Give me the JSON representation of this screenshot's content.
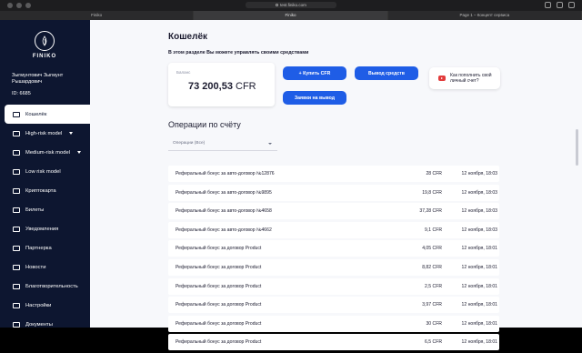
{
  "browser": {
    "url": "test.finiko.com",
    "tabs": [
      "Finiko",
      "Finiko",
      "Page 1 – Концепт сервиса"
    ]
  },
  "sidebar": {
    "logo_text": "FINIKO",
    "user_name": "Зыгмунтович Зыгмунт Рышардович",
    "user_id": "ID: 6685",
    "items": [
      {
        "label": "Кошелёк",
        "icon": "wallet-icon",
        "active": true
      },
      {
        "label": "High-risk model",
        "icon": "chart-icon",
        "has_caret": true
      },
      {
        "label": "Medium-risk model",
        "icon": "chart-icon",
        "has_caret": true
      },
      {
        "label": "Low risk model",
        "icon": "chart-icon"
      },
      {
        "label": "Криптокарта",
        "icon": "card-icon"
      },
      {
        "label": "Билеты",
        "icon": "ticket-icon"
      },
      {
        "label": "Уведомления",
        "icon": "bell-icon"
      },
      {
        "label": "Партнерка",
        "icon": "partners-icon"
      },
      {
        "label": "Новости",
        "icon": "news-icon"
      },
      {
        "label": "Благотворительность",
        "icon": "heart-icon"
      },
      {
        "label": "Настройки",
        "icon": "gear-icon"
      },
      {
        "label": "Документы",
        "icon": "document-icon"
      }
    ]
  },
  "main": {
    "title": "Кошелёк",
    "subtitle": "В этом разделе Вы можете управлять своими средствами",
    "balance_label": "Баланс",
    "balance_value": "73 200,53",
    "balance_currency": "CFR",
    "buttons": {
      "buy": "+ Купить CFR",
      "withdraw": "Вывод средств",
      "requests": "Заявки на вывод"
    },
    "help_text": "Как пополнить свой личный счет?",
    "ops_title": "Операции по счёту",
    "ops_filter": "Операции (Все)",
    "operations": [
      {
        "desc": "Реферальный бонус за авто-договор №12876",
        "amount": "28 CFR",
        "date": "12 ноября, 18:03"
      },
      {
        "desc": "Реферальный бонус за авто-договор №9895",
        "amount": "19,8 CFR",
        "date": "12 ноября, 18:03"
      },
      {
        "desc": "Реферальный бонус за авто-договор №4658",
        "amount": "37,28 CFR",
        "date": "12 ноября, 18:03"
      },
      {
        "desc": "Реферальный бонус за авто-договор №4662",
        "amount": "9,1 CFR",
        "date": "12 ноября, 18:03"
      },
      {
        "desc": "Реферальный бонус за договор Product",
        "amount": "4,05 CFR",
        "date": "12 ноября, 18:01"
      },
      {
        "desc": "Реферальный бонус за договор Product",
        "amount": "8,82 CFR",
        "date": "12 ноября, 18:01"
      },
      {
        "desc": "Реферальный бонус за договор Product",
        "amount": "2,5 CFR",
        "date": "12 ноября, 18:01"
      },
      {
        "desc": "Реферальный бонус за договор Product",
        "amount": "3,97 CFR",
        "date": "12 ноября, 18:01"
      },
      {
        "desc": "Реферальный бонус за договор Product",
        "amount": "30 CFR",
        "date": "12 ноября, 18:01"
      },
      {
        "desc": "Реферальный бонус за договор Product",
        "amount": "6,5 CFR",
        "date": "12 ноября, 18:01"
      }
    ]
  }
}
